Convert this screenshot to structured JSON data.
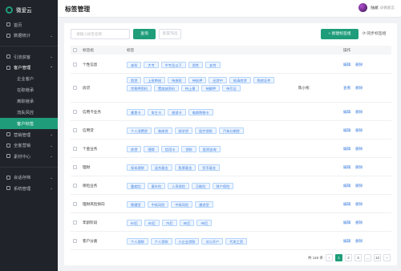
{
  "app": {
    "name": "微爱云"
  },
  "sidebar": {
    "items": [
      {
        "label": "首页"
      },
      {
        "label": "数据统计"
      },
      {
        "label": "引流获客"
      },
      {
        "label": "客户管理"
      },
      {
        "label": "营销管理"
      },
      {
        "label": "全客营销"
      },
      {
        "label": "素材中心"
      },
      {
        "label": "会话存档"
      },
      {
        "label": "系统管理"
      }
    ],
    "subitems": [
      {
        "label": "企业客户"
      },
      {
        "label": "在职继承"
      },
      {
        "label": "离职继承"
      },
      {
        "label": "流失风控"
      },
      {
        "label": "客户标签"
      }
    ]
  },
  "header": {
    "title": "标签管理",
    "user": "陆斌",
    "company": "@微爱云"
  },
  "toolbar": {
    "search_placeholder": "请输入标签名称",
    "query_label": "查询",
    "reset_label": "重置筛选",
    "new_label": "+ 新建标签组",
    "sync_label": "同步标签组"
  },
  "table": {
    "headers": {
      "group": "标签组",
      "tags": "标签",
      "ops": "操作"
    },
    "rows": [
      {
        "group": "个性信息",
        "tags": [
          "本科",
          "大专",
          "中专及以下",
          "男性",
          "女性"
        ],
        "owner": "",
        "ops": [
          "编辑",
          "删除"
        ]
      },
      {
        "group": "房贷",
        "tags": [
          "首贷",
          "上班审核",
          "待放款",
          "待抵押",
          "还贷中",
          "结清房贷",
          "购房证件",
          "完税押资料",
          "置加缺资料",
          "待上报",
          "待解押",
          "待写证"
        ],
        "owner": "陈小彤",
        "ops": [
          "查看",
          "删除"
        ]
      },
      {
        "group": "信用卡业务",
        "tags": [
          "美食卡",
          "车主卡",
          "旅游卡",
          "电商购物卡"
        ],
        "owner": "",
        "ops": [
          "编辑",
          "删除"
        ]
      },
      {
        "group": "信用贷",
        "tags": [
          "个人消费贷",
          "装修贷",
          "助学贷",
          "医疗贷款",
          "汽车分期贷"
        ],
        "owner": "",
        "ops": [
          "编辑",
          "删除"
        ]
      },
      {
        "group": "个金业务",
        "tags": [
          "房贷",
          "理财",
          "信用卡",
          "贷款",
          "投资咨询"
        ],
        "owner": "",
        "ops": [
          "编辑",
          "删除"
        ]
      },
      {
        "group": "理财",
        "tags": [
          "保本理财",
          "混合基金",
          "股票基金",
          "货币基金"
        ],
        "owner": "",
        "ops": [
          "编辑",
          "删除"
        ]
      },
      {
        "group": "保险业务",
        "tags": [
          "重疾险",
          "意外险",
          "人寿保险",
          "万能险",
          "财产保险"
        ],
        "owner": "",
        "ops": [
          "编辑",
          "删除"
        ]
      },
      {
        "group": "理财风险倾向",
        "tags": [
          "稳健型",
          "中低风险",
          "中高风险",
          "激进型"
        ],
        "owner": "",
        "ops": [
          "编辑",
          "删除"
        ]
      },
      {
        "group": "年龄阶段",
        "tags": [
          "50后",
          "60后",
          "70后",
          "80后",
          "90后"
        ],
        "owner": "",
        "ops": [
          "编辑",
          "删除"
        ]
      },
      {
        "group": "客户分类",
        "tags": [
          "个人理财",
          "个人贷款",
          "小企业贷款",
          "对公开户",
          "代发工资"
        ],
        "owner": "",
        "ops": [
          "编辑",
          "删除"
        ]
      }
    ]
  },
  "pagination": {
    "total": "共 118 条",
    "prev": "‹",
    "pages": [
      "1",
      "2",
      "3",
      "...",
      "12"
    ],
    "next": "›"
  }
}
